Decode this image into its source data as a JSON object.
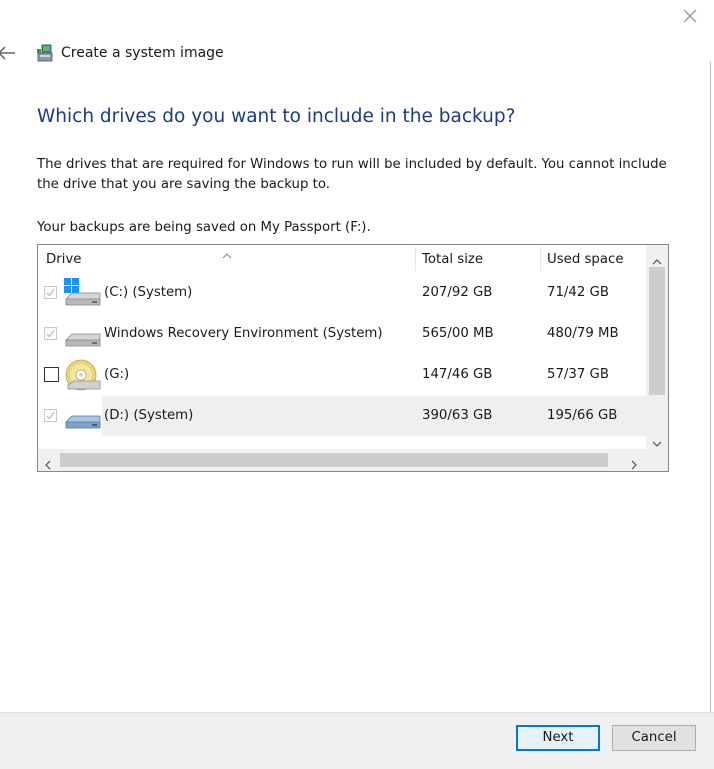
{
  "window": {
    "title": "Create a system image"
  },
  "page": {
    "heading": "Which drives do you want to include in the backup?",
    "description": "The drives that are required for Windows to run will be included by default. You cannot include the drive that you are saving the backup to.",
    "save_location": "Your backups are being saved on My Passport (F:)."
  },
  "table": {
    "columns": [
      "Drive",
      "Total size",
      "Used space"
    ],
    "rows": [
      {
        "drive": "(C:) (System)",
        "total": "207/92 GB",
        "used": "71/42 GB",
        "icon": "windows-drive-icon",
        "checked": true,
        "disabled": true
      },
      {
        "drive": "Windows Recovery Environment (System)",
        "total": "565/00 MB",
        "used": "480/79 MB",
        "icon": "hard-drive-icon",
        "checked": true,
        "disabled": true
      },
      {
        "drive": "(G:)",
        "total": "147/46 GB",
        "used": "57/37 GB",
        "icon": "optical-drive-icon",
        "checked": false,
        "disabled": false
      },
      {
        "drive": "(D:) (System)",
        "total": "390/63 GB",
        "used": "195/66 GB",
        "icon": "blue-hard-drive-icon",
        "checked": true,
        "disabled": true
      }
    ]
  },
  "buttons": {
    "next": "Next",
    "cancel": "Cancel"
  },
  "colors": {
    "heading": "#1c3a8c",
    "primary_border": "#0078d7",
    "footer": "#f0f0f0"
  }
}
